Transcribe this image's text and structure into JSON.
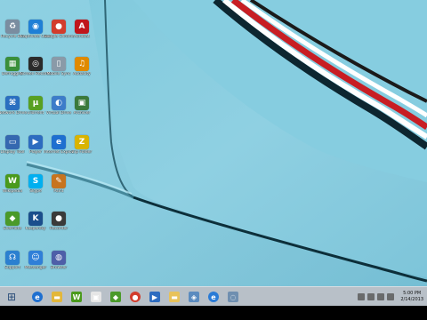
{
  "desktop": {
    "icons": [
      {
        "name": "recycle-bin-icon",
        "label": "Recycle Bin",
        "glyph": "♻",
        "color": "#7a8da0"
      },
      {
        "name": "app-blue-drop-icon",
        "label": "Captivate Cloud",
        "glyph": "◉",
        "color": "#1f7fd6"
      },
      {
        "name": "chrome-icon",
        "label": "Google Chrome",
        "glyph": "●",
        "color": "#d23c2c"
      },
      {
        "name": "acrobat-icon",
        "label": "Acrobat",
        "glyph": "A",
        "color": "#c0161b"
      },
      {
        "name": "app-grid-icon",
        "label": "Defraggler",
        "glyph": "▦",
        "color": "#3a8f3a"
      },
      {
        "name": "camera-icon",
        "label": "Screen Recorder",
        "glyph": "◎",
        "color": "#2b2b2b"
      },
      {
        "name": "device-icon",
        "label": "Mobile Sync",
        "glyph": "▯",
        "color": "#8a9aa8"
      },
      {
        "name": "headphones-icon",
        "label": "Audacity",
        "glyph": "♫",
        "color": "#e08a00"
      },
      {
        "name": "network-icon",
        "label": "Network Drive",
        "glyph": "⌘",
        "color": "#2a6fc0"
      },
      {
        "name": "utorrent-icon",
        "label": "uTorrent",
        "glyph": "µ",
        "color": "#58a022"
      },
      {
        "name": "disc-icon",
        "label": "Virtual Drive",
        "glyph": "◐",
        "color": "#3d7cc9"
      },
      {
        "name": "archive-icon",
        "label": "Archiver",
        "glyph": "▣",
        "color": "#3b7a3b"
      },
      {
        "name": "monitor-icon",
        "label": "Display Tool",
        "glyph": "▭",
        "color": "#3568b0"
      },
      {
        "name": "media-icon",
        "label": "Player",
        "glyph": "▶",
        "color": "#2d6cc0"
      },
      {
        "name": "ie-icon",
        "label": "Internet Explorer",
        "glyph": "e",
        "color": "#1e6fd0"
      },
      {
        "name": "zip-icon",
        "label": "Zip Folder",
        "glyph": "Z",
        "color": "#d9b400"
      },
      {
        "name": "wiki-icon",
        "label": "Wikipedia",
        "glyph": "W",
        "color": "#4a9a1c"
      },
      {
        "name": "skype-icon",
        "label": "Skype",
        "glyph": "S",
        "color": "#00aff0"
      },
      {
        "name": "paint-icon",
        "label": "Paint",
        "glyph": "✎",
        "color": "#c7741f"
      },
      {
        "name": "green-app-icon",
        "label": "Evernote",
        "glyph": "◆",
        "color": "#4a9a2a"
      },
      {
        "name": "k-app-icon",
        "label": "Kaspersky",
        "glyph": "K",
        "color": "#1a4e8c"
      },
      {
        "name": "dark-app-icon",
        "label": "Recorder",
        "glyph": "●",
        "color": "#3a3a3a"
      },
      {
        "name": "headset-icon",
        "label": "Support",
        "glyph": "☊",
        "color": "#2b80d0"
      },
      {
        "name": "chat-icon",
        "label": "Messenger",
        "glyph": "☺",
        "color": "#2f7fd8"
      },
      {
        "name": "globe-icon",
        "label": "Browser",
        "glyph": "◍",
        "color": "#4e5fa8"
      }
    ]
  },
  "taskbar": {
    "start_glyph": "⊞",
    "apps": [
      {
        "name": "taskbar-ie-icon",
        "glyph": "e",
        "color": "#1e6fd0",
        "round": true
      },
      {
        "name": "taskbar-explorer-icon",
        "glyph": "▬",
        "color": "#e3b73a",
        "round": false
      },
      {
        "name": "taskbar-word-icon",
        "glyph": "W",
        "color": "#4a9a1c",
        "round": false
      },
      {
        "name": "taskbar-store-icon",
        "glyph": "▣",
        "color": "#e6e6e6",
        "round": false
      },
      {
        "name": "taskbar-evernote-icon",
        "glyph": "◆",
        "color": "#4a9a2a",
        "round": false
      },
      {
        "name": "taskbar-chrome-icon",
        "glyph": "●",
        "color": "#d23c2c",
        "round": true
      },
      {
        "name": "taskbar-media-icon",
        "glyph": "▶",
        "color": "#2d6cc0",
        "round": false
      },
      {
        "name": "taskbar-folder-icon",
        "glyph": "▬",
        "color": "#e8c25a",
        "round": false
      },
      {
        "name": "taskbar-tool-icon",
        "glyph": "◈",
        "color": "#5b8bbf",
        "round": false
      },
      {
        "name": "taskbar-ie2-icon",
        "glyph": "e",
        "color": "#2a7bd6",
        "round": true
      },
      {
        "name": "taskbar-app-icon",
        "glyph": "◌",
        "color": "#6f8fb0",
        "round": false
      }
    ],
    "clock_time": "5:00 PM",
    "clock_date": "2/14/2013"
  }
}
